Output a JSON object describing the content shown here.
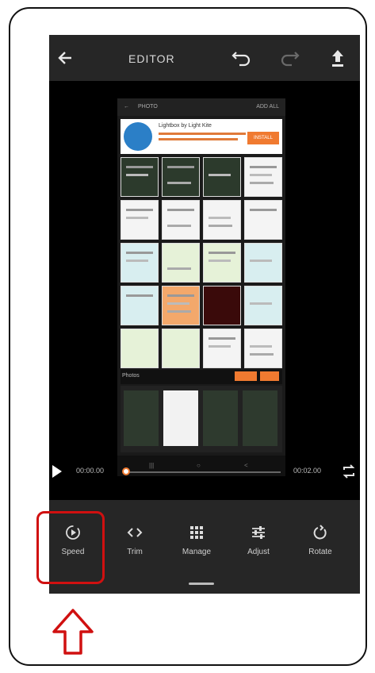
{
  "topbar": {
    "title": "EDITOR",
    "back_icon": "arrow-left-icon",
    "undo_icon": "undo-icon",
    "redo_icon": "redo-icon",
    "upload_icon": "upload-icon"
  },
  "preview": {
    "header_left": "PHOTO",
    "header_right": "ADD ALL",
    "ad_title": "Lightbox by Light Kite",
    "ad_button": "INSTALL",
    "photos_label": "Photos",
    "nav": [
      "|||",
      "○",
      "<"
    ]
  },
  "player": {
    "current_time": "00:00.00",
    "total_time": "00:02.00",
    "progress": 0
  },
  "tools": [
    {
      "label": "Speed",
      "icon": "speed-icon"
    },
    {
      "label": "Trim",
      "icon": "trim-icon"
    },
    {
      "label": "Manage",
      "icon": "grid-icon"
    },
    {
      "label": "Adjust",
      "icon": "sliders-icon"
    },
    {
      "label": "Rotate",
      "icon": "rotate-icon"
    }
  ],
  "annotation": {
    "highlight_color": "#d01010",
    "arrow_icon": "up-arrow-icon"
  }
}
